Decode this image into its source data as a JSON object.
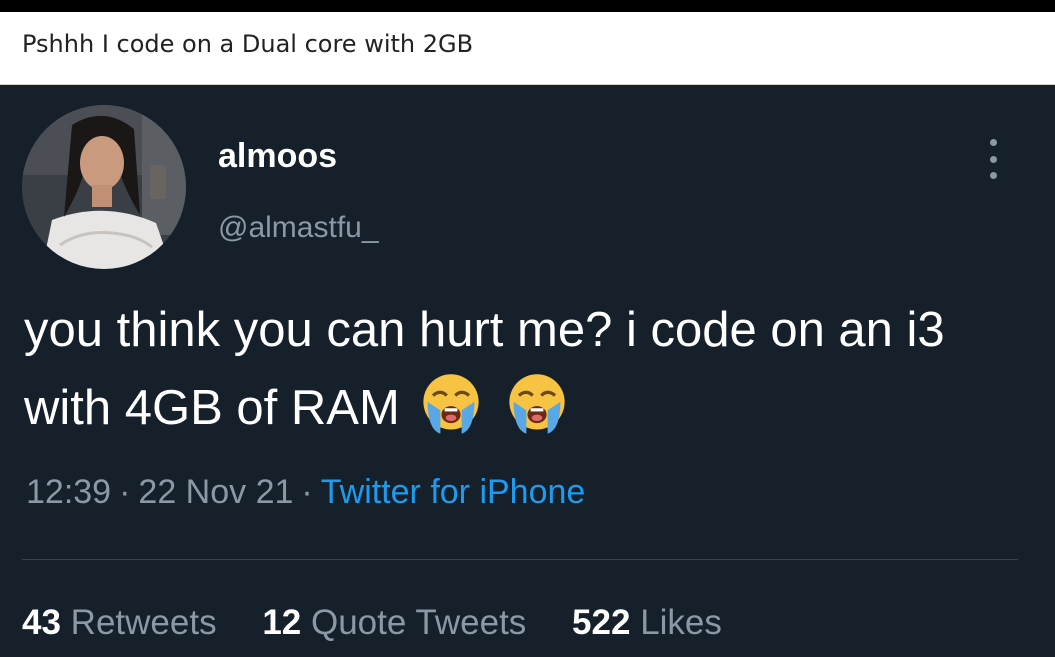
{
  "caption": {
    "text": "Pshhh I code on a Dual core with 2GB"
  },
  "tweet": {
    "display_name": "almoos",
    "handle": "@almastfu_",
    "text": "you think you can hurt me? i code on an i3 with 4GB of RAM",
    "emojis": [
      "loudly-crying-face",
      "loudly-crying-face"
    ],
    "time": "12:39",
    "date": "22 Nov 21",
    "separator": "·",
    "source": "Twitter for iPhone",
    "stats": {
      "retweets": {
        "count": "43",
        "label": "Retweets"
      },
      "quotes": {
        "count": "12",
        "label": "Quote Tweets"
      },
      "likes": {
        "count": "522",
        "label": "Likes"
      }
    }
  },
  "colors": {
    "background": "#15202b",
    "primary_text": "#ffffff",
    "secondary_text": "#8b98a5",
    "link": "#1d9bf0"
  }
}
